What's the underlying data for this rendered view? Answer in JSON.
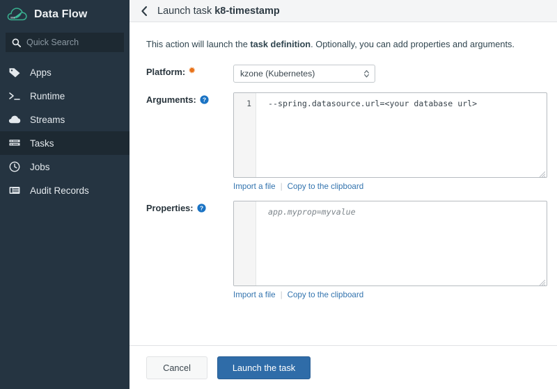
{
  "sidebar": {
    "brand": "Data Flow",
    "brand_logo_icon": "spring-cloud-leaf-logo",
    "search": {
      "placeholder": "Quick Search",
      "icon": "search-icon"
    },
    "items": [
      {
        "label": "Apps",
        "icon": "tag-icon",
        "active": false
      },
      {
        "label": "Runtime",
        "icon": "terminal-icon",
        "active": false
      },
      {
        "label": "Streams",
        "icon": "cloud-icon",
        "active": false
      },
      {
        "label": "Tasks",
        "icon": "tasks-icon",
        "active": true
      },
      {
        "label": "Jobs",
        "icon": "clock-icon",
        "active": false
      },
      {
        "label": "Audit Records",
        "icon": "records-icon",
        "active": false
      }
    ],
    "colors": {
      "background": "#253441",
      "active_background": "#1d2932",
      "text": "#e4e9ed",
      "logo_green": "#34a186"
    }
  },
  "header": {
    "back_icon": "chevron-left-icon",
    "title_prefix": "Launch task ",
    "title_name": "k8-timestamp"
  },
  "main": {
    "intro_before": "This action will launch the ",
    "intro_bold": "task definition",
    "intro_after": ". Optionally, you can add properties and arguments.",
    "platform": {
      "label": "Platform:",
      "required_marker": "✹",
      "required_color": "#e8731b",
      "selected_value": "kzone (Kubernetes)",
      "caret_icon": "chevron-updown-icon"
    },
    "arguments": {
      "label": "Arguments:",
      "help_icon": "help-circle-icon",
      "line_number": "1",
      "value": "--spring.datasource.url=<your database url>",
      "is_placeholder": false,
      "import_link": "Import a file",
      "separator": "|",
      "copy_link": "Copy to the clipboard",
      "resize_icon": "resize-grip-icon"
    },
    "properties": {
      "label": "Properties:",
      "help_icon": "help-circle-icon",
      "line_number": "",
      "value": "app.myprop=myvalue",
      "is_placeholder": true,
      "import_link": "Import a file",
      "separator": "|",
      "copy_link": "Copy to the clipboard",
      "resize_icon": "resize-grip-icon"
    }
  },
  "footer": {
    "cancel_label": "Cancel",
    "launch_label": "Launch the task",
    "primary_color": "#2f6ca8"
  }
}
